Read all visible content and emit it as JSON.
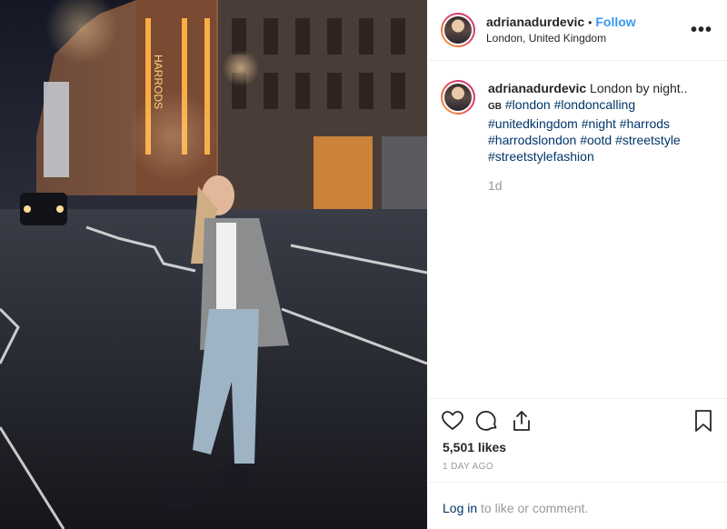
{
  "post": {
    "username": "adrianadurdevic",
    "separator": "•",
    "follow_label": "Follow",
    "location": "London, United Kingdom",
    "more_label": "•••"
  },
  "caption": {
    "username": "adrianadurdevic",
    "text": "London by night..",
    "flag": "GB",
    "hashtags_line1": [
      "#london",
      "#londoncalling"
    ],
    "hashtags_line2": [
      "#unitedkingdom",
      "#night",
      "#harrods"
    ],
    "hashtags_line3": [
      "#harrodslondon",
      "#ootd",
      "#streetstyle"
    ],
    "hashtags_line4": [
      "#streetstylefashion"
    ],
    "time": "1d"
  },
  "actions": {
    "like_icon": "heart-icon",
    "comment_icon": "comment-icon",
    "share_icon": "share-icon",
    "save_icon": "bookmark-icon"
  },
  "stats": {
    "likes": "5,501 likes",
    "posted_ago": "1 DAY AGO"
  },
  "comment": {
    "login_label": "Log in",
    "login_suffix": " to like or comment."
  },
  "colors": {
    "link_blue": "#3897f0",
    "hashtag": "#003569",
    "muted": "#999999",
    "text": "#262626",
    "border": "#efefef"
  }
}
